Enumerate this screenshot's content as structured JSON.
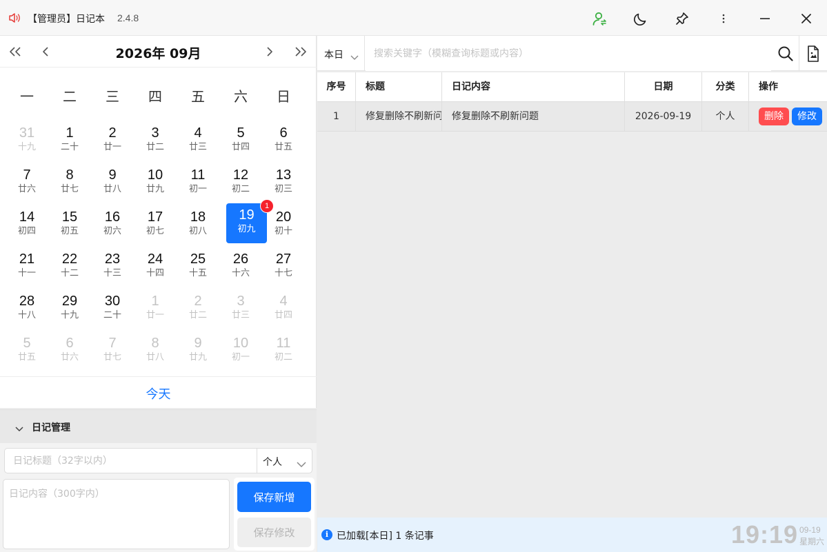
{
  "app": {
    "title": "【管理员】日记本",
    "version": "2.4.8",
    "accent_color": "#1677ff",
    "danger_color": "#ff4d4f",
    "logo_icon": "speaker-icon",
    "controls": [
      "user-switch-icon",
      "moon-icon",
      "pin-icon",
      "more-icon",
      "minimize-icon",
      "close-icon"
    ]
  },
  "calendar": {
    "month_label": "2026年  09月",
    "weekdays": [
      "一",
      "二",
      "三",
      "四",
      "五",
      "六",
      "日"
    ],
    "today_label": "今天",
    "selected_day": "19",
    "badge_count": "1",
    "days": [
      {
        "num": "31",
        "lunar": "十九",
        "other": true
      },
      {
        "num": "1",
        "lunar": "二十"
      },
      {
        "num": "2",
        "lunar": "廿一"
      },
      {
        "num": "3",
        "lunar": "廿二"
      },
      {
        "num": "4",
        "lunar": "廿三"
      },
      {
        "num": "5",
        "lunar": "廿四"
      },
      {
        "num": "6",
        "lunar": "廿五"
      },
      {
        "num": "7",
        "lunar": "廿六"
      },
      {
        "num": "8",
        "lunar": "廿七"
      },
      {
        "num": "9",
        "lunar": "廿八"
      },
      {
        "num": "10",
        "lunar": "廿九"
      },
      {
        "num": "11",
        "lunar": "初一"
      },
      {
        "num": "12",
        "lunar": "初二"
      },
      {
        "num": "13",
        "lunar": "初三"
      },
      {
        "num": "14",
        "lunar": "初四"
      },
      {
        "num": "15",
        "lunar": "初五"
      },
      {
        "num": "16",
        "lunar": "初六"
      },
      {
        "num": "17",
        "lunar": "初七"
      },
      {
        "num": "18",
        "lunar": "初八"
      },
      {
        "num": "19",
        "lunar": "初九",
        "selected": true
      },
      {
        "num": "20",
        "lunar": "初十"
      },
      {
        "num": "21",
        "lunar": "十一"
      },
      {
        "num": "22",
        "lunar": "十二"
      },
      {
        "num": "23",
        "lunar": "十三"
      },
      {
        "num": "24",
        "lunar": "十四"
      },
      {
        "num": "25",
        "lunar": "十五"
      },
      {
        "num": "26",
        "lunar": "十六"
      },
      {
        "num": "27",
        "lunar": "十七"
      },
      {
        "num": "28",
        "lunar": "十八"
      },
      {
        "num": "29",
        "lunar": "十九"
      },
      {
        "num": "30",
        "lunar": "二十"
      },
      {
        "num": "1",
        "lunar": "廿一",
        "other": true
      },
      {
        "num": "2",
        "lunar": "廿二",
        "other": true
      },
      {
        "num": "3",
        "lunar": "廿三",
        "other": true
      },
      {
        "num": "4",
        "lunar": "廿四",
        "other": true
      },
      {
        "num": "5",
        "lunar": "廿五",
        "other": true
      },
      {
        "num": "6",
        "lunar": "廿六",
        "other": true
      },
      {
        "num": "7",
        "lunar": "廿七",
        "other": true
      },
      {
        "num": "8",
        "lunar": "廿八",
        "other": true
      },
      {
        "num": "9",
        "lunar": "廿九",
        "other": true
      },
      {
        "num": "10",
        "lunar": "初一",
        "other": true
      },
      {
        "num": "11",
        "lunar": "初二",
        "other": true
      }
    ]
  },
  "manage": {
    "header": "日记管理",
    "title_placeholder": "日记标题（32字以内）",
    "category_value": "个人",
    "content_placeholder": "日记内容（300字内）",
    "save_new_label": "保存新增",
    "save_edit_label": "保存修改"
  },
  "search": {
    "range_value": "本日",
    "placeholder": "搜索关键字（模糊查询标题或内容）"
  },
  "table": {
    "headers": {
      "no": "序号",
      "title": "标题",
      "content": "日记内容",
      "date": "日期",
      "category": "分类",
      "actions": "操作"
    },
    "rows": [
      {
        "no": "1",
        "title": "修复删除不刷新问题",
        "content": "修复删除不刷新问题",
        "date": "2026-09-19",
        "category": "个人",
        "delete_label": "删除",
        "edit_label": "修改"
      }
    ]
  },
  "status": {
    "message": "已加载[本日] 1 条记事",
    "clock": "19:19",
    "date": "09-19",
    "weekday": "星期六"
  }
}
